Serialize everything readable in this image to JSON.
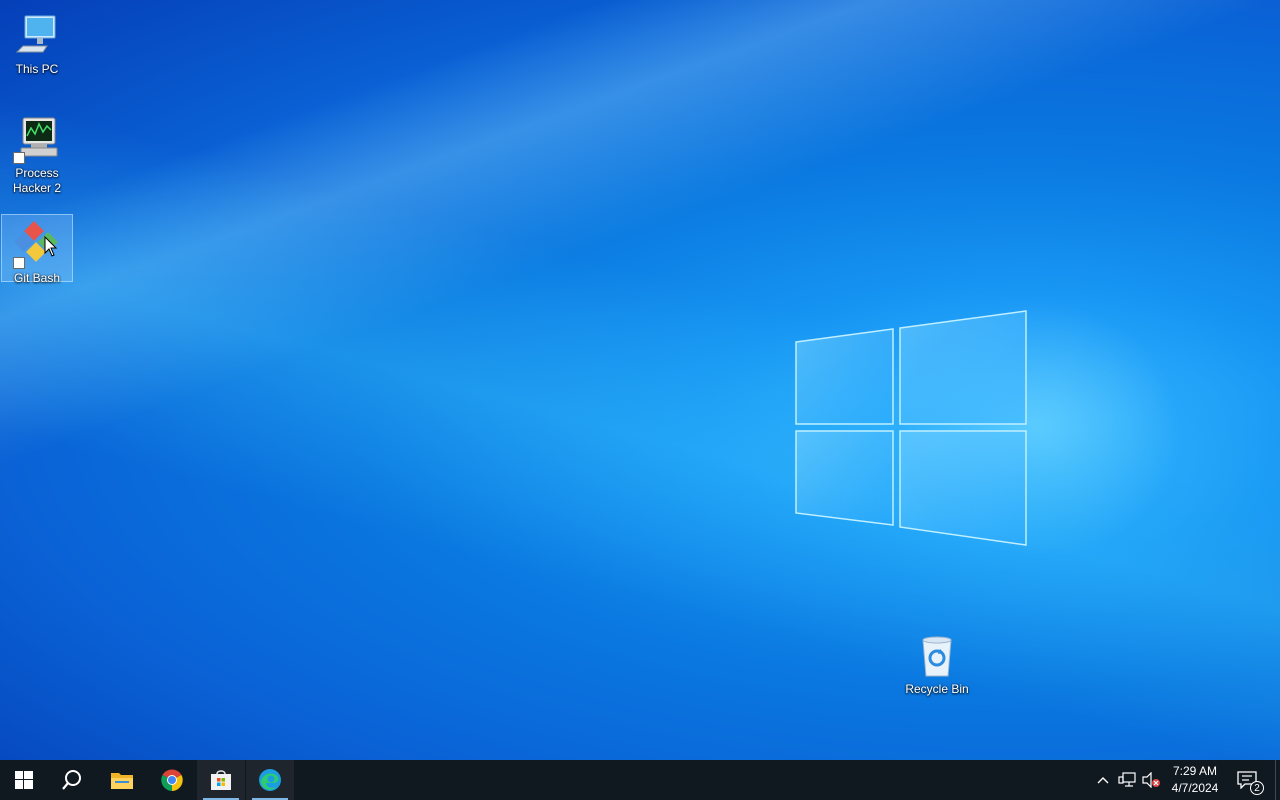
{
  "desktop": {
    "icons": [
      {
        "label": "This PC",
        "icon": "computer-icon"
      },
      {
        "label": "Process Hacker 2",
        "icon": "process-hacker-icon"
      },
      {
        "label": "Git Bash",
        "icon": "git-bash-icon",
        "selected": true
      },
      {
        "label": "Recycle Bin",
        "icon": "recycle-bin-icon"
      }
    ]
  },
  "taskbar": {
    "buttons": [
      {
        "name": "start-button",
        "icon": "windows-start-icon"
      },
      {
        "name": "search-button",
        "icon": "search-icon"
      },
      {
        "name": "file-explorer-button",
        "icon": "folder-icon"
      },
      {
        "name": "chrome-button",
        "icon": "chrome-icon"
      },
      {
        "name": "microsoft-store-button",
        "icon": "store-icon",
        "running": true
      },
      {
        "name": "edge-button",
        "icon": "edge-icon",
        "running": true
      }
    ],
    "tray": {
      "icons": [
        "chevron-up-icon",
        "network-icon",
        "volume-muted-icon"
      ],
      "time": "7:29 AM",
      "date": "4/7/2024",
      "notification_count": "2"
    }
  },
  "colors": {
    "taskbar": "#101820",
    "running_indicator": "#7fb6e6",
    "wallpaper_accent": "#1695f3"
  }
}
